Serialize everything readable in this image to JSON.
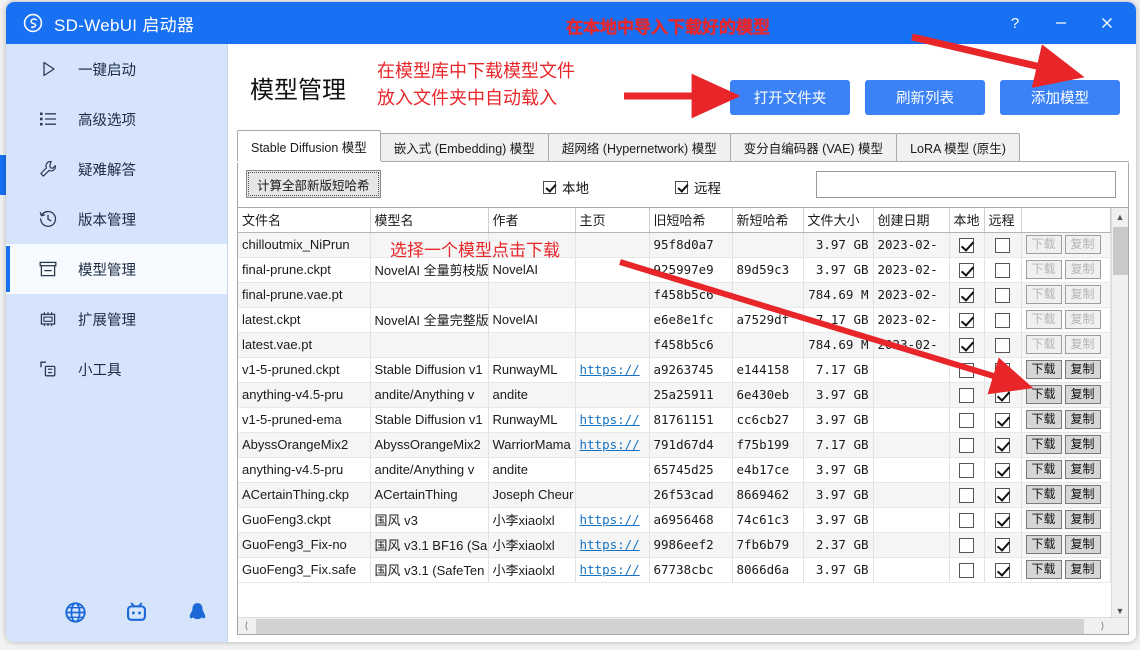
{
  "window": {
    "title": "SD-WebUI 启动器",
    "logo_icon": "sd-webui-logo-icon",
    "help_label": "?",
    "minimize_label": "—",
    "close_label": "✕",
    "title_annotation": "在本地中导入下载好的模型",
    "accent_color": "#1871f3",
    "annotation_color": "#e8262a"
  },
  "sidebar": {
    "items": [
      {
        "label": "一键启动",
        "icon": "play-triangle-icon",
        "active": false
      },
      {
        "label": "高级选项",
        "icon": "list-options-icon",
        "active": false
      },
      {
        "label": "疑难解答",
        "icon": "wrench-icon",
        "active": false
      },
      {
        "label": "版本管理",
        "icon": "history-clock-icon",
        "active": false
      },
      {
        "label": "模型管理",
        "icon": "archive-box-icon",
        "active": true
      },
      {
        "label": "扩展管理",
        "icon": "chip-icon",
        "active": false
      },
      {
        "label": "小工具",
        "icon": "toolbox-icon",
        "active": false
      }
    ],
    "bottom_icons": [
      {
        "name": "globe-icon"
      },
      {
        "name": "bilibili-icon"
      },
      {
        "name": "qq-penguin-icon"
      }
    ]
  },
  "header": {
    "page_title": "模型管理",
    "annotation_line1": "在模型库中下载模型文件",
    "annotation_line2": "放入文件夹中自动载入",
    "buttons": [
      {
        "label": "打开文件夹",
        "name": "open-folder-button"
      },
      {
        "label": "刷新列表",
        "name": "refresh-list-button"
      },
      {
        "label": "添加模型",
        "name": "add-model-button"
      }
    ]
  },
  "tabs": [
    {
      "label": "Stable Diffusion 模型",
      "active": true
    },
    {
      "label": "嵌入式 (Embedding) 模型",
      "active": false
    },
    {
      "label": "超网络 (Hypernetwork) 模型",
      "active": false
    },
    {
      "label": "变分自编码器 (VAE) 模型",
      "active": false
    },
    {
      "label": "LoRA 模型 (原生)",
      "active": false
    }
  ],
  "filterbar": {
    "hash_button_label": "计算全部新版短哈希",
    "local_label": "本地",
    "local_checked": true,
    "remote_label": "远程",
    "remote_checked": true,
    "search_value": "",
    "search_placeholder": ""
  },
  "table": {
    "columns": [
      "文件名",
      "模型名",
      "作者",
      "主页",
      "旧短哈希",
      "新短哈希",
      "文件大小",
      "创建日期",
      "本地",
      "远程",
      ""
    ],
    "row_buttons": {
      "download": "下载",
      "copy": "复制"
    },
    "link_text": "https://",
    "rows": [
      {
        "filename": "chilloutmix_NiPrun",
        "modelname": "",
        "author": "",
        "homepage": "",
        "old_hash": "95f8d0a7",
        "new_hash": "",
        "size": "3.97 GB",
        "date": "2023-02-",
        "local": true,
        "remote": false,
        "btn_enabled": false
      },
      {
        "filename": "final-prune.ckpt",
        "modelname": "NovelAI 全量剪枝版",
        "author": "NovelAI",
        "homepage": "",
        "old_hash": "925997e9",
        "new_hash": "89d59c3",
        "size": "3.97 GB",
        "date": "2023-02-",
        "local": true,
        "remote": false,
        "btn_enabled": false
      },
      {
        "filename": "final-prune.vae.pt",
        "modelname": "",
        "author": "",
        "homepage": "",
        "old_hash": "f458b5c6",
        "new_hash": "",
        "size": "784.69 M",
        "date": "2023-02-",
        "local": true,
        "remote": false,
        "btn_enabled": false
      },
      {
        "filename": "latest.ckpt",
        "modelname": "NovelAI 全量完整版",
        "author": "NovelAI",
        "homepage": "",
        "old_hash": "e6e8e1fc",
        "new_hash": "a7529df",
        "size": "7.17 GB",
        "date": "2023-02-",
        "local": true,
        "remote": false,
        "btn_enabled": false
      },
      {
        "filename": "latest.vae.pt",
        "modelname": "",
        "author": "",
        "homepage": "",
        "old_hash": "f458b5c6",
        "new_hash": "",
        "size": "784.69 M",
        "date": "2023-02-",
        "local": true,
        "remote": false,
        "btn_enabled": false
      },
      {
        "filename": "v1-5-pruned.ckpt",
        "modelname": "Stable Diffusion v1",
        "author": "RunwayML",
        "homepage": "https://",
        "old_hash": "a9263745",
        "new_hash": "e144158",
        "size": "7.17 GB",
        "date": "",
        "local": false,
        "remote": true,
        "btn_enabled": true
      },
      {
        "filename": "anything-v4.5-pru",
        "modelname": "andite/Anything v",
        "author": "andite",
        "homepage": "",
        "old_hash": "25a25911",
        "new_hash": "6e430eb",
        "size": "3.97 GB",
        "date": "",
        "local": false,
        "remote": true,
        "btn_enabled": true
      },
      {
        "filename": "v1-5-pruned-ema",
        "modelname": "Stable Diffusion v1",
        "author": "RunwayML",
        "homepage": "https://",
        "old_hash": "81761151",
        "new_hash": "cc6cb27",
        "size": "3.97 GB",
        "date": "",
        "local": false,
        "remote": true,
        "btn_enabled": true
      },
      {
        "filename": "AbyssOrangeMix2",
        "modelname": "AbyssOrangeMix2",
        "author": "WarriorMama",
        "homepage": "https://",
        "old_hash": "791d67d4",
        "new_hash": "f75b199",
        "size": "7.17 GB",
        "date": "",
        "local": false,
        "remote": true,
        "btn_enabled": true
      },
      {
        "filename": "anything-v4.5-pru",
        "modelname": "andite/Anything v",
        "author": "andite",
        "homepage": "",
        "old_hash": "65745d25",
        "new_hash": "e4b17ce",
        "size": "3.97 GB",
        "date": "",
        "local": false,
        "remote": true,
        "btn_enabled": true
      },
      {
        "filename": "ACertainThing.ckp",
        "modelname": "ACertainThing",
        "author": "Joseph Cheur",
        "homepage": "",
        "old_hash": "26f53cad",
        "new_hash": "8669462",
        "size": "3.97 GB",
        "date": "",
        "local": false,
        "remote": true,
        "btn_enabled": true
      },
      {
        "filename": "GuoFeng3.ckpt",
        "modelname": "国风 v3",
        "author": "小李xiaolxl",
        "homepage": "https://",
        "old_hash": "a6956468",
        "new_hash": "74c61c3",
        "size": "3.97 GB",
        "date": "",
        "local": false,
        "remote": true,
        "btn_enabled": true
      },
      {
        "filename": "GuoFeng3_Fix-no",
        "modelname": "国风 v3.1 BF16 (Sa",
        "author": "小李xiaolxl",
        "homepage": "https://",
        "old_hash": "9986eef2",
        "new_hash": "7fb6b79",
        "size": "2.37 GB",
        "date": "",
        "local": false,
        "remote": true,
        "btn_enabled": true
      },
      {
        "filename": "GuoFeng3_Fix.safe",
        "modelname": "国风 v3.1 (SafeTen",
        "author": "小李xiaolxl",
        "homepage": "https://",
        "old_hash": "67738cbc",
        "new_hash": "8066d6a",
        "size": "3.97 GB",
        "date": "",
        "local": false,
        "remote": true,
        "btn_enabled": true
      }
    ]
  },
  "annotations": {
    "select_model_hint": "选择一个模型点击下载"
  }
}
